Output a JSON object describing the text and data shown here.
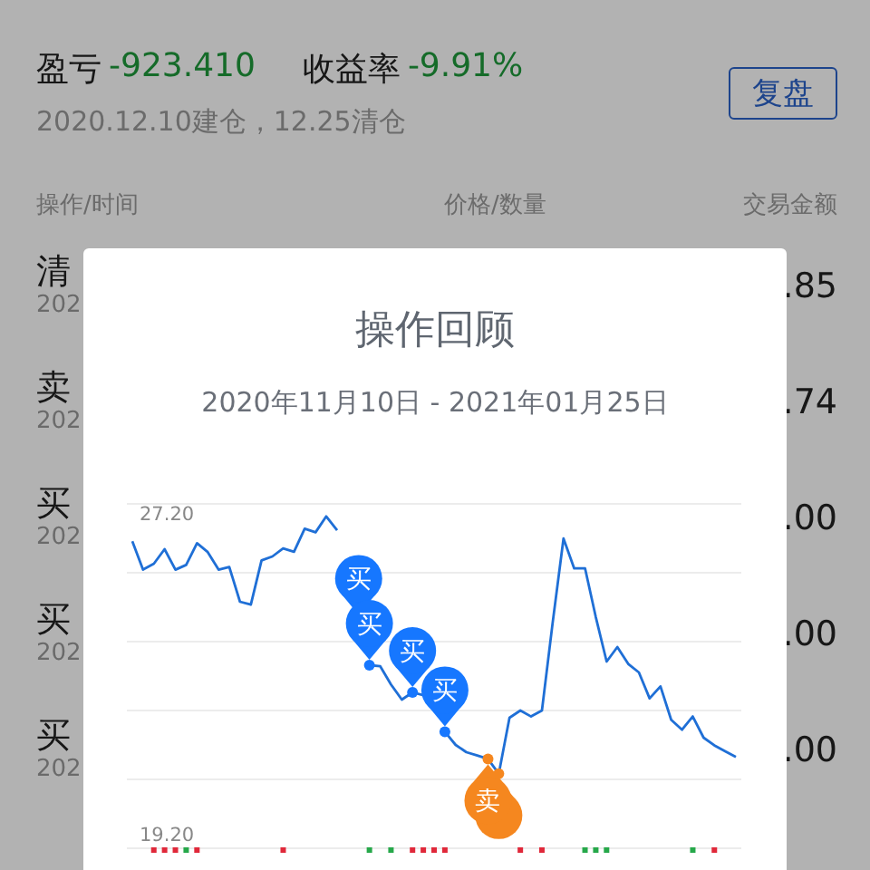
{
  "summary": {
    "pnl_label": "盈亏",
    "pnl_value": "-923.410",
    "rate_label": "收益率",
    "rate_value": "-9.91%",
    "subtitle": "2020.12.10建仓，12.25清仓",
    "button": "复盘"
  },
  "table": {
    "columns": [
      "操作/时间",
      "价格/数量",
      "交易金额"
    ],
    "rows": [
      {
        "action": "清",
        "date": "202",
        "amount": ".85"
      },
      {
        "action": "卖",
        "date": "202",
        "amount": ".74"
      },
      {
        "action": "买",
        "date": "202",
        "amount": ".00"
      },
      {
        "action": "买",
        "date": "202",
        "amount": ".00"
      },
      {
        "action": "买",
        "date": "202",
        "amount": ".00"
      }
    ]
  },
  "modal": {
    "title": "操作回顾",
    "date_range": "2020年11月10日 - 2021年01月25日",
    "chart_data": {
      "type": "line",
      "ylim": [
        19.2,
        27.2
      ],
      "yticks": [
        {
          "value": 27.2,
          "label": "27.20"
        },
        {
          "value": 19.2,
          "label": "19.20"
        }
      ],
      "series": [
        {
          "color": "#1f6fd6",
          "values": [
            26.54,
            25.83,
            25.98,
            26.34,
            25.83,
            25.95,
            26.49,
            26.27,
            25.83,
            25.9,
            25.03,
            24.96,
            26.06,
            26.16,
            26.36,
            26.28,
            26.85,
            26.76,
            27.16,
            26.81,
            null,
            null,
            23.45,
            23.42,
            22.97,
            22.59,
            22.77,
            22.7,
            null,
            21.79,
            21.46,
            21.28,
            21.2,
            21.11,
            20.74,
            22.14,
            22.32,
            22.17,
            22.32,
            24.5,
            26.61,
            25.86,
            25.86,
            24.65,
            23.54,
            23.9,
            23.48,
            23.27,
            22.62,
            22.92,
            22.09,
            21.84,
            22.17,
            21.64,
            21.45,
            21.3,
            21.16
          ]
        }
      ]
    },
    "pins": [
      {
        "kind": "buy",
        "label": "买"
      },
      {
        "kind": "buy",
        "label": "买"
      },
      {
        "kind": "buy",
        "label": "买"
      },
      {
        "kind": "buy",
        "label": "买"
      },
      {
        "kind": "sell"
      },
      {
        "kind": "sell",
        "label": "卖"
      }
    ],
    "markers": [
      {
        "color": "#e0283a"
      },
      {
        "color": "#e0283a"
      },
      {
        "color": "#e0283a"
      },
      {
        "color": "#26a84a"
      },
      {
        "color": "#e0283a"
      },
      {
        "color": "#e0283a"
      },
      {
        "color": "#26a84a"
      },
      {
        "color": "#26a84a"
      },
      {
        "color": "#e0283a"
      },
      {
        "color": "#e0283a"
      },
      {
        "color": "#e0283a"
      },
      {
        "color": "#e0283a"
      },
      {
        "color": "#e0283a"
      },
      {
        "color": "#e0283a"
      },
      {
        "color": "#26a84a"
      },
      {
        "color": "#26a84a"
      },
      {
        "color": "#26a84a"
      },
      {
        "color": "#26a84a"
      },
      {
        "color": "#e0283a"
      }
    ]
  }
}
